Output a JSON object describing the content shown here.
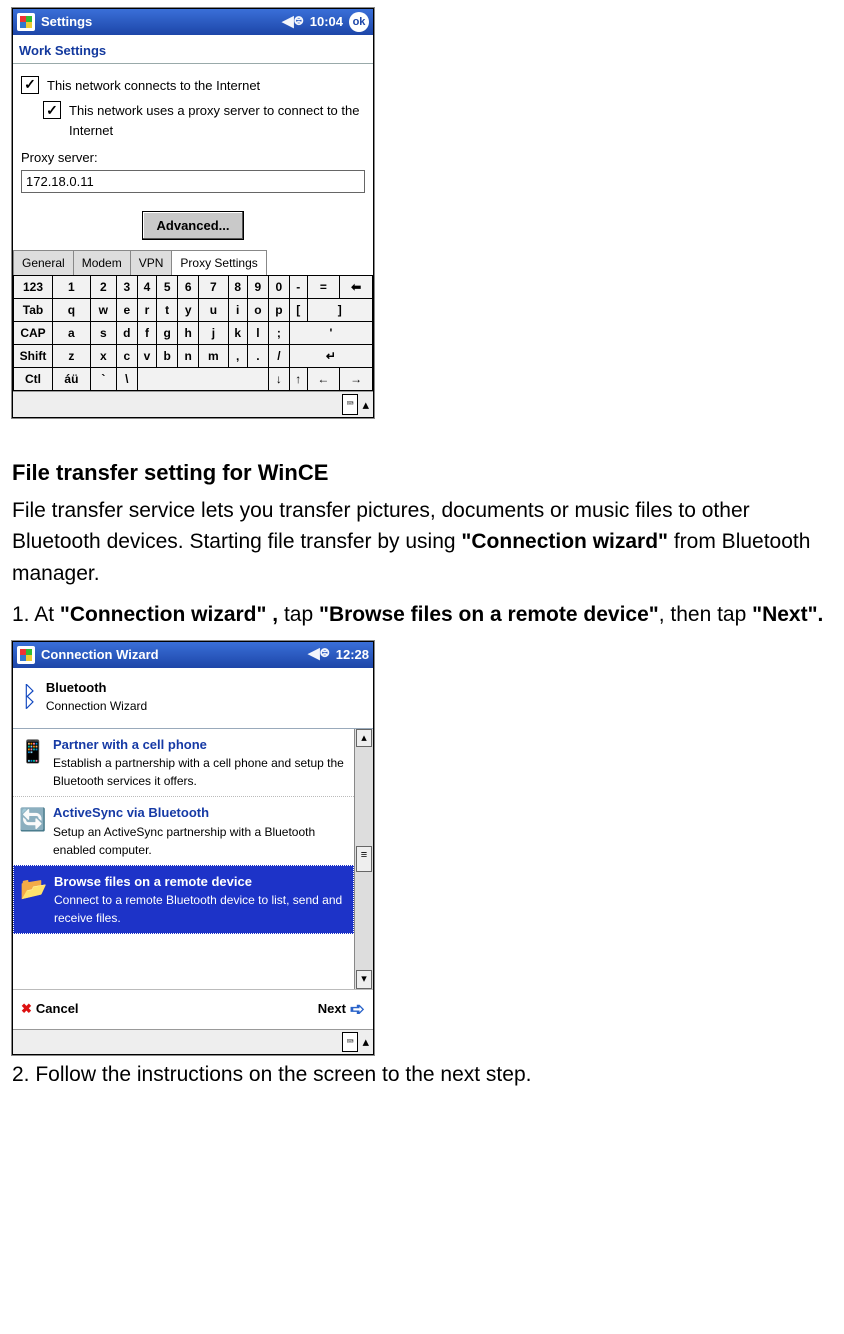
{
  "screen1": {
    "titlebar": {
      "title": "Settings",
      "time": "10:04",
      "ok": "ok"
    },
    "section_title": "Work Settings",
    "check_internet": "This network connects to the Internet",
    "check_proxy": "This network uses a proxy server to connect to the Internet",
    "proxy_label": "Proxy server:",
    "proxy_value": "172.18.0.11",
    "advanced_btn": "Advanced...",
    "tabs": {
      "general": "General",
      "modem": "Modem",
      "vpn": "VPN",
      "proxy": "Proxy Settings"
    },
    "keyboard": {
      "row1": [
        "123",
        "1",
        "2",
        "3",
        "4",
        "5",
        "6",
        "7",
        "8",
        "9",
        "0",
        "-",
        "=",
        "⬅"
      ],
      "row2": [
        "Tab",
        "q",
        "w",
        "e",
        "r",
        "t",
        "y",
        "u",
        "i",
        "o",
        "p",
        "[",
        "]"
      ],
      "row3": [
        "CAP",
        "a",
        "s",
        "d",
        "f",
        "g",
        "h",
        "j",
        "k",
        "l",
        ";",
        "'"
      ],
      "row4": [
        "Shift",
        "z",
        "x",
        "c",
        "v",
        "b",
        "n",
        "m",
        ",",
        ".",
        "/",
        "↵"
      ],
      "row5": [
        "Ctl",
        "áü",
        "`",
        "\\",
        " ",
        "↓",
        "↑",
        "←",
        "→"
      ]
    }
  },
  "doc": {
    "heading": "File transfer setting for WinCE",
    "p1_a": "File transfer service lets you transfer pictures, documents or music files to other Bluetooth devices. Starting file transfer by using ",
    "p1_b": "\"Connection wizard\"",
    "p1_c": " from Bluetooth manager.",
    "step1_a": "1. At ",
    "step1_b": "\"Connection wizard\" ,",
    "step1_c": " tap ",
    "step1_d": "\"Browse files on a remote device\"",
    "step1_e": ", then tap ",
    "step1_f": "\"Next\".",
    "step2": "2. Follow the instructions on the screen to the next step."
  },
  "screen2": {
    "titlebar": {
      "title": "Connection Wizard",
      "time": "12:28"
    },
    "head_title": "Bluetooth",
    "head_sub": "Connection Wizard",
    "items": [
      {
        "title": "Partner with a cell phone",
        "desc": "Establish a partnership with a cell phone and setup the Bluetooth services it offers."
      },
      {
        "title": "ActiveSync via Bluetooth",
        "desc": "Setup an ActiveSync partnership with a Bluetooth enabled computer."
      },
      {
        "title": "Browse files on a remote device",
        "desc": "Connect to a remote Bluetooth device to list, send and receive files."
      }
    ],
    "cancel": "Cancel",
    "next": "Next"
  }
}
